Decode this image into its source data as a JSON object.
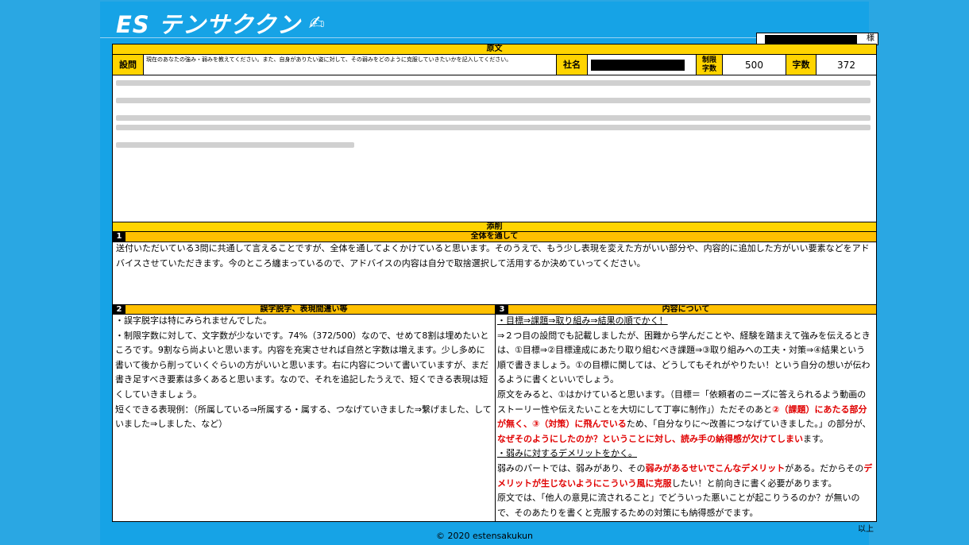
{
  "app": {
    "logo_text": "ES テンサククン",
    "logo_icon": "pen-writing-icon"
  },
  "header": {
    "honorific": "様"
  },
  "original": {
    "section_title": "原文",
    "question_label": "設問",
    "question_text": "現在のあなたの強み・弱みを教えてください。また、自身がありたい姿に対して、その弱みをどのように克服していきたいかを記入してください。",
    "company_label": "社名",
    "limit_label": "制限字数",
    "limit_value": "500",
    "count_label": "字数",
    "count_value": "372"
  },
  "correction": {
    "section_title": "添削",
    "s1": {
      "number": "1",
      "title": "全体を通して",
      "body": "送付いただいている3問に共通して言えることですが、全体を通してよくかけていると思います。そのうえで、もう少し表現を変えた方がいい部分や、内容的に追加した方がいい要素などをアドバイスさせていただきます。今のところ纏まっているので、アドバイスの内容は自分で取捨選択して活用するか決めていってください。"
    },
    "s2": {
      "number": "2",
      "title": "誤字脱字、表現間違い等",
      "lines": [
        "・誤字脱字は特にみられませんでした。",
        "・制限字数に対して、文字数が少ないです。74%（372/500）なので、せめて8割は埋めたいところです。9割なら尚よいと思います。内容を充実させれば自然と字数は増えます。少し多めに書いて後から削っていくぐらいの方がいいと思います。右に内容について書いていますが、まだ書き足すべき要素は多くあると思います。なので、それを追記したうえで、短くできる表現は短くしていきましょう。",
        "短くできる表現例：（所属している⇒所属する・属する、つなげていきました⇒繋げました、していました⇒しました、など）"
      ]
    },
    "s3": {
      "number": "3",
      "title": "内容について",
      "h1": "・目標⇒課題⇒取り組み⇒結果の順でかく！",
      "p1": "⇒２つ目の設問でも記載しましたが、困難から学んだことや、経験を踏まえて強みを伝えるときは、①目標⇒②目標達成にあたり取り組むべき課題⇒③取り組みへの工夫・対策⇒④結果という順で書きましょう。①の目標に関しては、どうしてもそれがやりたい！という自分の想いが伝わるように書くといいでしょう。",
      "p2a": "原文をみると、①はかけていると思います。（目標＝「依頼者のニーズに答えられるよう動画のストーリー性や伝えたいことを大切にして丁寧に制作」）ただそのあと",
      "p2b": "②（課題）にあたる部分が無く、③（対策）に飛んでいる",
      "p2c": "ため、「自分なりに～改善につなげていきました。」の部分が、",
      "p2d": "なぜそのようにしたのか？ということに対し、読み手の納得感が欠けてしまい",
      "p2e": "ます。",
      "h2": "・弱みに対するデメリットをかく。",
      "p3a": "弱みのパートでは、弱みがあり、その",
      "p3b": "弱みがあるせいでこんなデメリット",
      "p3c": "がある。だからその",
      "p3d": "デメリットが生じないようにこういう風に克服",
      "p3e": "したい！と前向きに書く必要があります。",
      "p4": "原文では、「他人の意見に流されること」でどういった悪いことが起こりうるのか？が無いので、そのあたりを書くと克服するための対策にも納得感がでます。"
    }
  },
  "end_label": "以上",
  "footer": "© 2020 estensakukun"
}
